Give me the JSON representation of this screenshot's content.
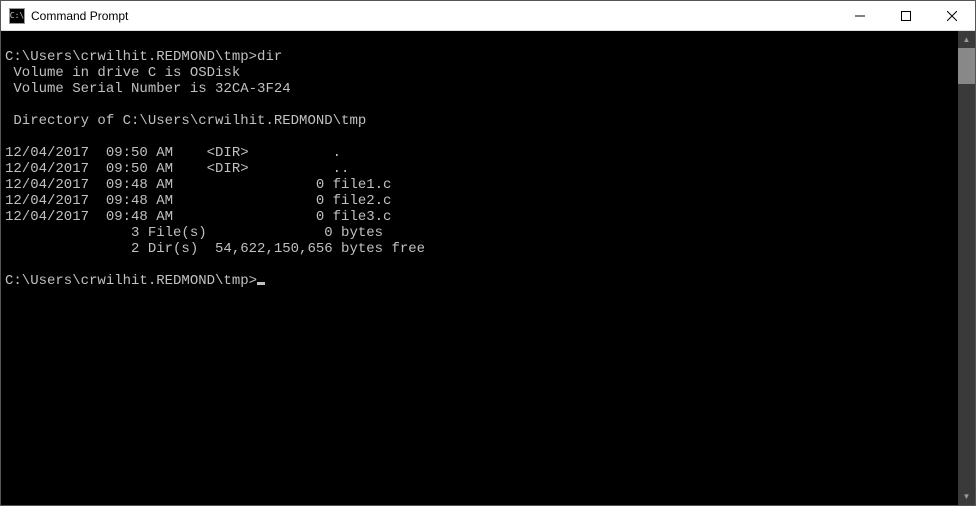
{
  "window": {
    "title": "Command Prompt",
    "icon_label": "C:\\"
  },
  "terminal": {
    "session": [
      {
        "prompt": "C:\\Users\\crwilhit.REDMOND\\tmp>",
        "command": "dir",
        "output": [
          " Volume in drive C is OSDisk",
          " Volume Serial Number is 32CA-3F24",
          "",
          " Directory of C:\\Users\\crwilhit.REDMOND\\tmp",
          "",
          "12/04/2017  09:50 AM    <DIR>          .",
          "12/04/2017  09:50 AM    <DIR>          ..",
          "12/04/2017  09:48 AM                 0 file1.c",
          "12/04/2017  09:48 AM                 0 file2.c",
          "12/04/2017  09:48 AM                 0 file3.c",
          "               3 File(s)              0 bytes",
          "               2 Dir(s)  54,622,150,656 bytes free"
        ]
      }
    ],
    "current_prompt": "C:\\Users\\crwilhit.REDMOND\\tmp>"
  }
}
